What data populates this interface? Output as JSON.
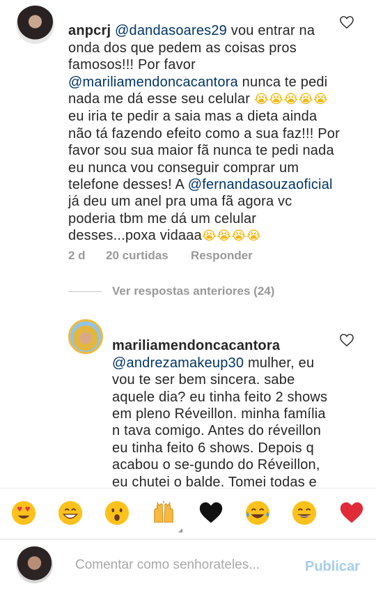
{
  "comment1": {
    "username": "anpcrj",
    "mention": "@dandasoares29",
    "text_a": " vou entrar na onda dos que pedem as coisas pros famosos!!! Por favor",
    "mention2": "@mariliamendoncacantora",
    "text_b": " nunca te pedi nada me dá esse seu celular ",
    "text_c": " eu iria te pedir a saia mas a dieta ainda não tá fazendo efeito como a sua faz!!! Por favor sou sua maior fã nunca te pedi nada eu nunca vou conseguir comprar um telefone desses! A ",
    "mention3": "@fernandasouzaoficial",
    "text_d": "já deu um anel pra uma fã agora vc poderia tbm me dá um celular desses...poxa vidaaa",
    "time": "2 d",
    "likes": "20 curtidas",
    "reply": "Responder"
  },
  "view_replies": "Ver respostas anteriores (24)",
  "comment2": {
    "username": "mariliamendoncacantora",
    "mention": "@andrezamakeup30",
    "text": " mulher, eu vou te ser bem sincera. sabe aquele dia? eu tinha feito 2 shows em pleno Réveillon. minha família n tava comigo. Antes do réveillon eu tinha feito 6 shows. Depois q acabou o se-gundo do Réveillon, eu chutei o balde. Tomei todas e mais algu-"
  },
  "emoji_bar": [
    "heart-eyes",
    "grinning",
    "surprised",
    "raised-hands",
    "black-heart",
    "tears-of-joy",
    "smiling",
    "red-heart"
  ],
  "composer": {
    "placeholder": "Comentar como senhorateles...",
    "publish": "Publicar"
  },
  "colors": {
    "mention": "#003569",
    "meta": "#999999",
    "publish": "#a6cdee",
    "heart": "#ed4956"
  }
}
